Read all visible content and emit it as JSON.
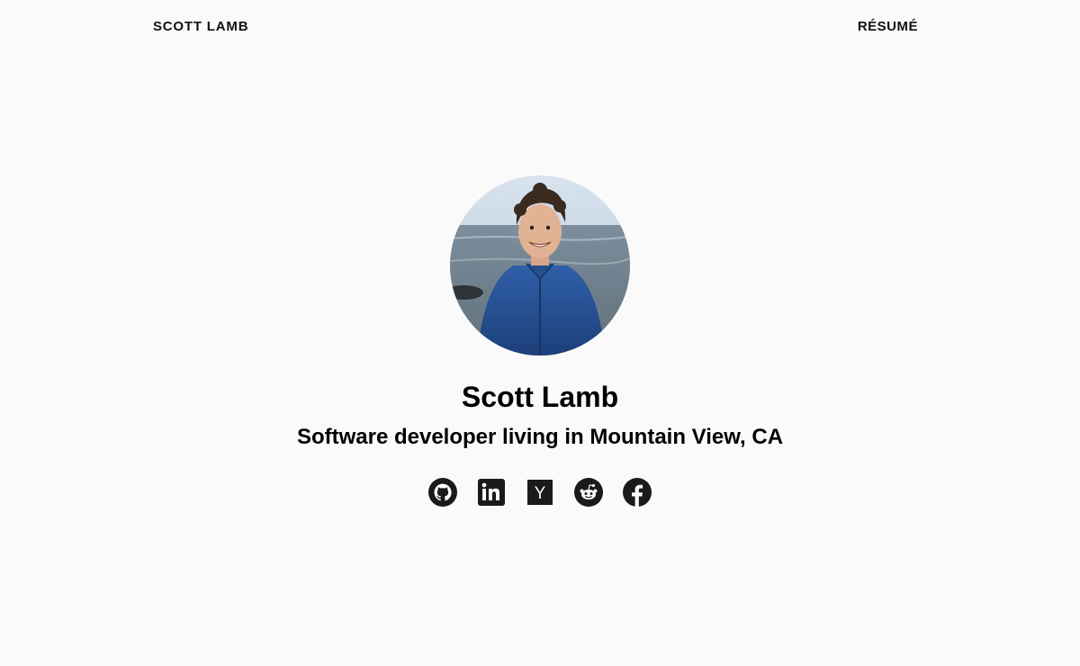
{
  "header": {
    "brand": "SCOTT LAMB",
    "resume_link": "RÉSUMÉ"
  },
  "profile": {
    "name": "Scott Lamb",
    "tagline": "Software developer living in Mountain View, CA"
  },
  "socials": [
    {
      "icon": "github-icon"
    },
    {
      "icon": "linkedin-icon"
    },
    {
      "icon": "hacker-news-icon",
      "glyph": "Y"
    },
    {
      "icon": "reddit-icon"
    },
    {
      "icon": "facebook-icon"
    }
  ],
  "colors": {
    "background": "#fafafa",
    "text": "#111111",
    "icon": "#1a1a1a"
  }
}
